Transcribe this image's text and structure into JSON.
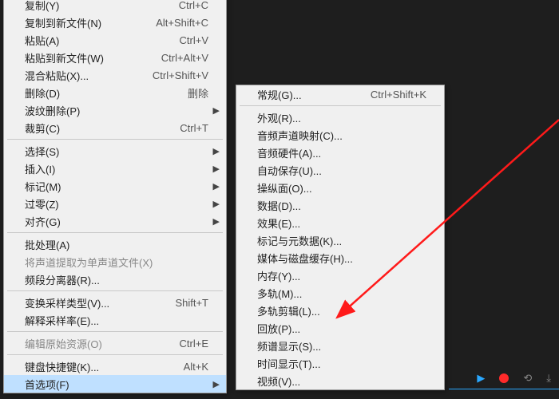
{
  "menu1": [
    {
      "t": "item",
      "label": "复制(Y)",
      "shortcut": "Ctrl+C"
    },
    {
      "t": "item",
      "label": "复制到新文件(N)",
      "shortcut": "Alt+Shift+C"
    },
    {
      "t": "item",
      "label": "粘贴(A)",
      "shortcut": "Ctrl+V"
    },
    {
      "t": "item",
      "label": "粘贴到新文件(W)",
      "shortcut": "Ctrl+Alt+V"
    },
    {
      "t": "item",
      "label": "混合粘贴(X)...",
      "shortcut": "Ctrl+Shift+V"
    },
    {
      "t": "item",
      "label": "删除(D)",
      "shortcut": "删除"
    },
    {
      "t": "item",
      "label": "波纹删除(P)",
      "sub": true
    },
    {
      "t": "item",
      "label": "裁剪(C)",
      "shortcut": "Ctrl+T"
    },
    {
      "t": "sep"
    },
    {
      "t": "item",
      "label": "选择(S)",
      "sub": true
    },
    {
      "t": "item",
      "label": "插入(I)",
      "sub": true
    },
    {
      "t": "item",
      "label": "标记(M)",
      "sub": true
    },
    {
      "t": "item",
      "label": "过零(Z)",
      "sub": true
    },
    {
      "t": "item",
      "label": "对齐(G)",
      "sub": true
    },
    {
      "t": "sep"
    },
    {
      "t": "item",
      "label": "批处理(A)"
    },
    {
      "t": "item",
      "label": "将声道提取为单声道文件(X)",
      "dim": true
    },
    {
      "t": "item",
      "label": "频段分离器(R)..."
    },
    {
      "t": "sep"
    },
    {
      "t": "item",
      "label": "变换采样类型(V)...",
      "shortcut": "Shift+T"
    },
    {
      "t": "item",
      "label": "解释采样率(E)..."
    },
    {
      "t": "sep"
    },
    {
      "t": "item",
      "label": "编辑原始资源(O)",
      "shortcut": "Ctrl+E",
      "dim": true
    },
    {
      "t": "sep"
    },
    {
      "t": "item",
      "label": "键盘快捷键(K)...",
      "shortcut": "Alt+K"
    },
    {
      "t": "item",
      "label": "首选项(F)",
      "sub": true,
      "hl": true
    }
  ],
  "menu2": [
    {
      "t": "item",
      "label": "常规(G)...",
      "shortcut": "Ctrl+Shift+K"
    },
    {
      "t": "sep"
    },
    {
      "t": "item",
      "label": "外观(R)..."
    },
    {
      "t": "item",
      "label": "音频声道映射(C)..."
    },
    {
      "t": "item",
      "label": "音频硬件(A)..."
    },
    {
      "t": "item",
      "label": "自动保存(U)..."
    },
    {
      "t": "item",
      "label": "操纵面(O)..."
    },
    {
      "t": "item",
      "label": "数据(D)..."
    },
    {
      "t": "item",
      "label": "效果(E)..."
    },
    {
      "t": "item",
      "label": "标记与元数据(K)..."
    },
    {
      "t": "item",
      "label": "媒体与磁盘缓存(H)..."
    },
    {
      "t": "item",
      "label": "内存(Y)..."
    },
    {
      "t": "item",
      "label": "多轨(M)..."
    },
    {
      "t": "item",
      "label": "多轨剪辑(L)..."
    },
    {
      "t": "item",
      "label": "回放(P)..."
    },
    {
      "t": "item",
      "label": "频谱显示(S)..."
    },
    {
      "t": "item",
      "label": "时间显示(T)..."
    },
    {
      "t": "item",
      "label": "视频(V)..."
    }
  ],
  "toolbar": {
    "play": "▶",
    "rec_color": "#ff2a2a",
    "blue": "#2aa8ff"
  }
}
